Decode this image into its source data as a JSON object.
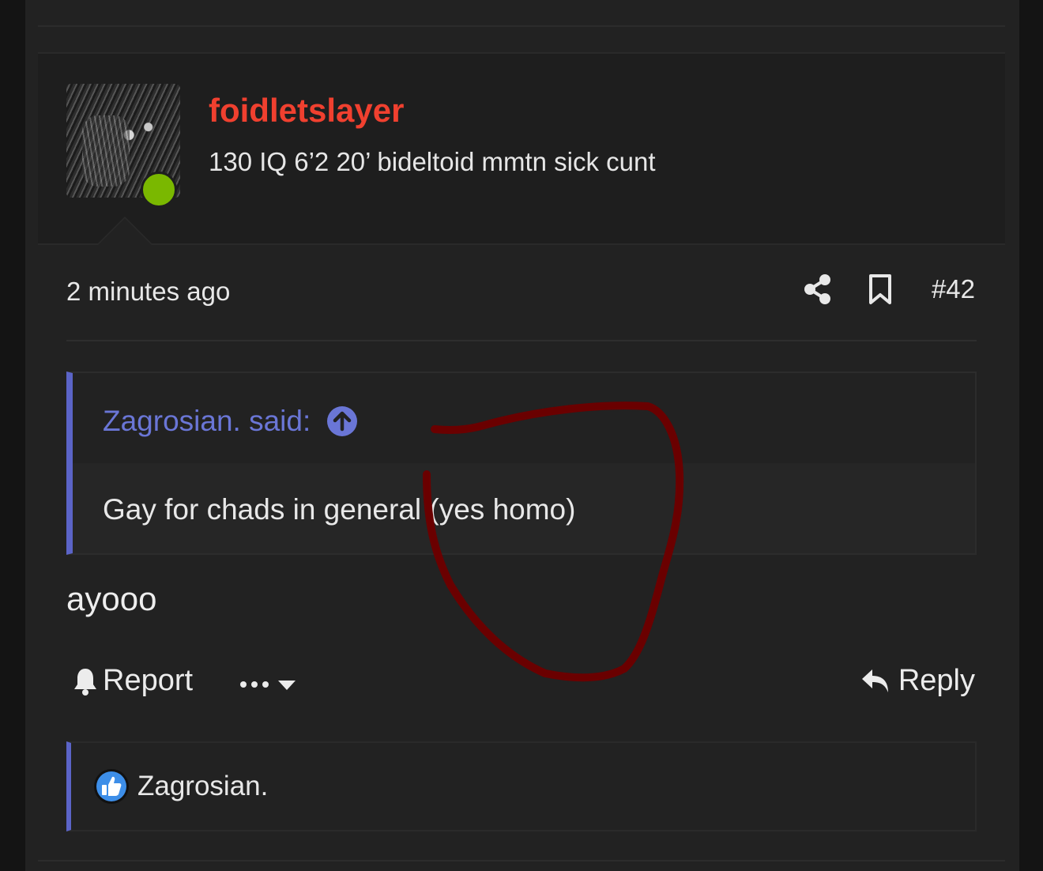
{
  "post": {
    "author": {
      "username": "foidletslayer",
      "title": "130 IQ 6’2 20’ bideltoid mmtn sick cunt",
      "online": true,
      "avatar_icon": "avatar-image"
    },
    "time": "2 minutes ago",
    "number": "#42",
    "quote": {
      "author_label": "Zagrosian. said:",
      "text": "Gay for chads in general (yes homo)"
    },
    "body": "ayooo",
    "footer": {
      "report_label": "Report",
      "reply_label": "Reply"
    },
    "reactions": {
      "users": "Zagrosian.",
      "icon": "thumbs-up-icon"
    }
  },
  "colors": {
    "username": "#f0402f",
    "accent": "#5b64c7",
    "quote_author": "#6a76d6",
    "online": "#7ab800",
    "scribble": "#6a0000"
  }
}
